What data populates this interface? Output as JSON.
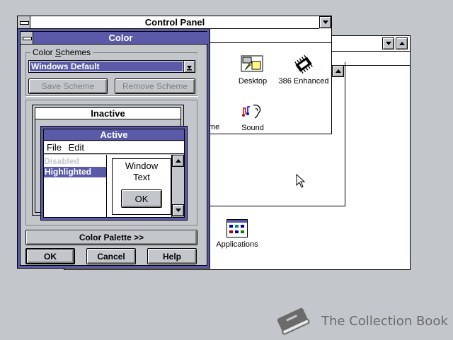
{
  "colors": {
    "desktop": "#c3c7cb",
    "active_title": "#5a5aa8",
    "highlight": "#5a5aa8",
    "face": "#c3c7cb"
  },
  "background_window": {
    "scroll_up_icon": "scroll-up-arrow"
  },
  "control_panel": {
    "title": "Control Panel",
    "icons": [
      {
        "label": "Desktop",
        "icon": "desktop-icon"
      },
      {
        "label": "386 Enhanced",
        "icon": "chip-icon"
      },
      {
        "label": "me",
        "icon": "time-icon"
      },
      {
        "label": "Sound",
        "icon": "sound-icon"
      }
    ]
  },
  "program_manager": {
    "icons": [
      {
        "label": "Applications",
        "icon": "applications-group-icon"
      }
    ]
  },
  "color_dialog": {
    "title": "Color",
    "schemes_label": "Color Schemes",
    "schemes_selected": "Windows Default",
    "save_scheme_label": "Save Scheme",
    "remove_scheme_label": "Remove Scheme",
    "preview": {
      "inactive_title": "Inactive",
      "active_title": "Active",
      "menu": [
        "File",
        "Edit"
      ],
      "disabled_text": "Disabled",
      "highlighted_text": "Highlighted",
      "window_text": "Window Text",
      "ok_label": "OK"
    },
    "color_palette_label": "Color Palette >>",
    "ok_label": "OK",
    "cancel_label": "Cancel",
    "help_label": "Help"
  },
  "watermark": {
    "text": "The Collection Book"
  }
}
